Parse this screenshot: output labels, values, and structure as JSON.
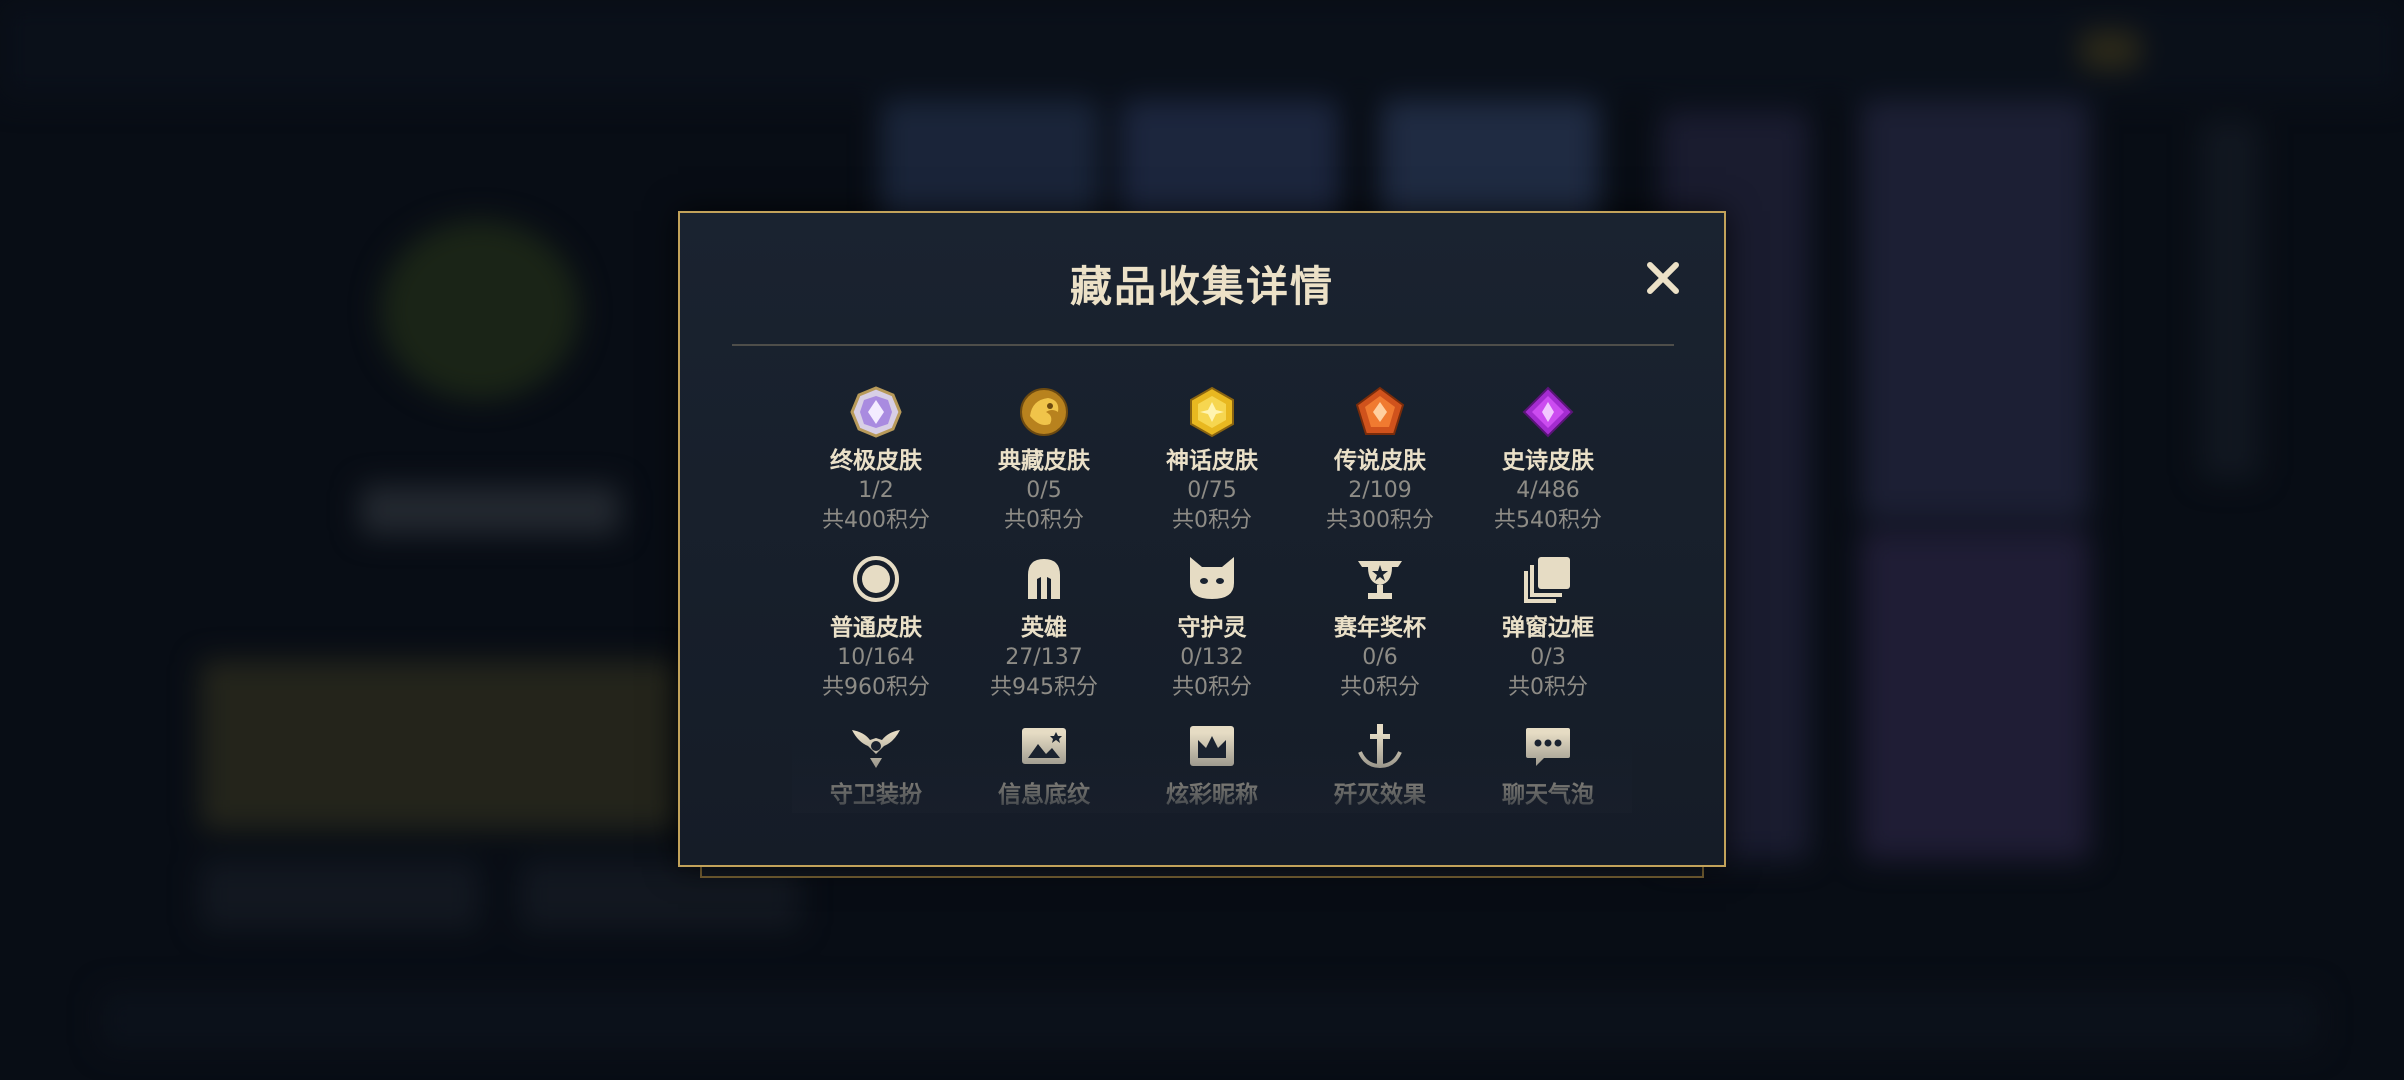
{
  "modal": {
    "title": "藏品收集详情",
    "close_icon": "close-icon",
    "accent_color": "#c2a25a",
    "items": [
      {
        "name": "终极皮肤",
        "count": "1/2",
        "points": "共400积分",
        "icon": "ultimate-skin-gem-icon"
      },
      {
        "name": "典藏皮肤",
        "count": "0/5",
        "points": "共0积分",
        "icon": "prestige-skin-dragon-icon"
      },
      {
        "name": "神话皮肤",
        "count": "0/75",
        "points": "共0积分",
        "icon": "mythic-skin-gem-icon"
      },
      {
        "name": "传说皮肤",
        "count": "2/109",
        "points": "共300积分",
        "icon": "legendary-skin-gem-icon"
      },
      {
        "name": "史诗皮肤",
        "count": "4/486",
        "points": "共540积分",
        "icon": "epic-skin-gem-icon"
      },
      {
        "name": "普通皮肤",
        "count": "10/164",
        "points": "共960积分",
        "icon": "standard-skin-circle-icon"
      },
      {
        "name": "英雄",
        "count": "27/137",
        "points": "共945积分",
        "icon": "champion-helmet-icon"
      },
      {
        "name": "守护灵",
        "count": "0/132",
        "points": "共0积分",
        "icon": "little-legend-face-icon"
      },
      {
        "name": "赛年奖杯",
        "count": "0/6",
        "points": "共0积分",
        "icon": "season-trophy-icon"
      },
      {
        "name": "弹窗边框",
        "count": "0/3",
        "points": "共0积分",
        "icon": "popup-frame-stack-icon"
      },
      {
        "name": "守卫装扮",
        "icon": "ward-skin-icon"
      },
      {
        "name": "信息底纹",
        "icon": "info-banner-icon"
      },
      {
        "name": "炫彩昵称",
        "icon": "colorful-nickname-crown-icon"
      },
      {
        "name": "歼灭效果",
        "icon": "ace-effect-sword-icon"
      },
      {
        "name": "聊天气泡",
        "icon": "chat-bubble-icon"
      }
    ]
  }
}
